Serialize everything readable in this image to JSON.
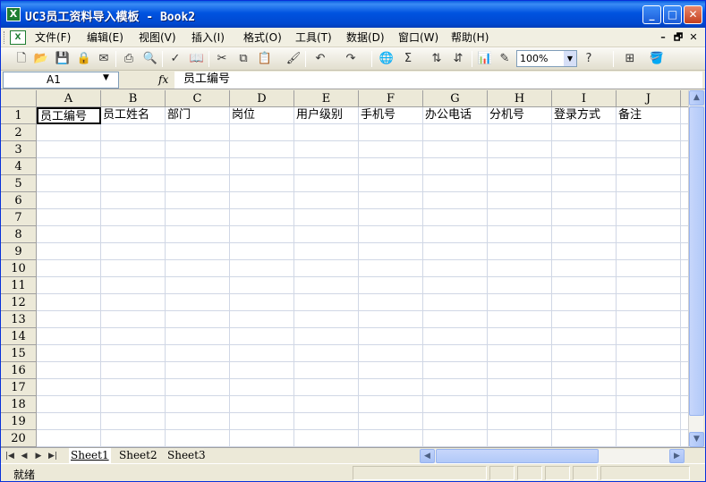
{
  "window": {
    "title": "UC3员工资料导入模板 - Book2",
    "app_icon": "excel-icon",
    "controls": {
      "minimize": "_",
      "maximize": "□",
      "close": "✕"
    }
  },
  "menu": {
    "items": [
      "文件(F)",
      "编辑(E)",
      "视图(V)",
      "插入(I)",
      "格式(O)",
      "工具(T)",
      "数据(D)",
      "窗口(W)",
      "帮助(H)"
    ],
    "doc_controls": {
      "minimize": "–",
      "restore": "🗗",
      "close": "✕"
    }
  },
  "toolbar": {
    "zoom": "100%",
    "icons": [
      "new-icon",
      "open-icon",
      "save-icon",
      "permission-icon",
      "email-icon",
      "print-icon",
      "print-preview-icon",
      "spelling-icon",
      "research-icon",
      "cut-icon",
      "copy-icon",
      "paste-icon",
      "format-painter-icon",
      "undo-icon",
      "redo-icon",
      "hyperlink-icon",
      "autosum-icon",
      "sort-ascending-icon",
      "sort-descending-icon",
      "chart-wizard-icon",
      "drawing-icon",
      "help-icon",
      "merge-center-icon",
      "fill-color-icon"
    ]
  },
  "formula_bar": {
    "cell_ref": "A1",
    "fx": "fx",
    "content": "员工编号"
  },
  "sheet": {
    "columns": [
      "A",
      "B",
      "C",
      "D",
      "E",
      "F",
      "G",
      "H",
      "I",
      "J"
    ],
    "rows": [
      "1",
      "2",
      "3",
      "4",
      "5",
      "6",
      "7",
      "8",
      "9",
      "10",
      "11",
      "12",
      "13",
      "14",
      "15",
      "16",
      "17",
      "18",
      "19",
      "20"
    ],
    "header_row": [
      "员工编号",
      "员工姓名",
      "部门",
      "岗位",
      "用户级别",
      "手机号",
      "办公电话",
      "分机号",
      "登录方式",
      "备注"
    ],
    "active_cell": "A1"
  },
  "tabs": {
    "sheets": [
      "Sheet1",
      "Sheet2",
      "Sheet3"
    ],
    "active": "Sheet1"
  },
  "status": {
    "text": "就绪"
  }
}
